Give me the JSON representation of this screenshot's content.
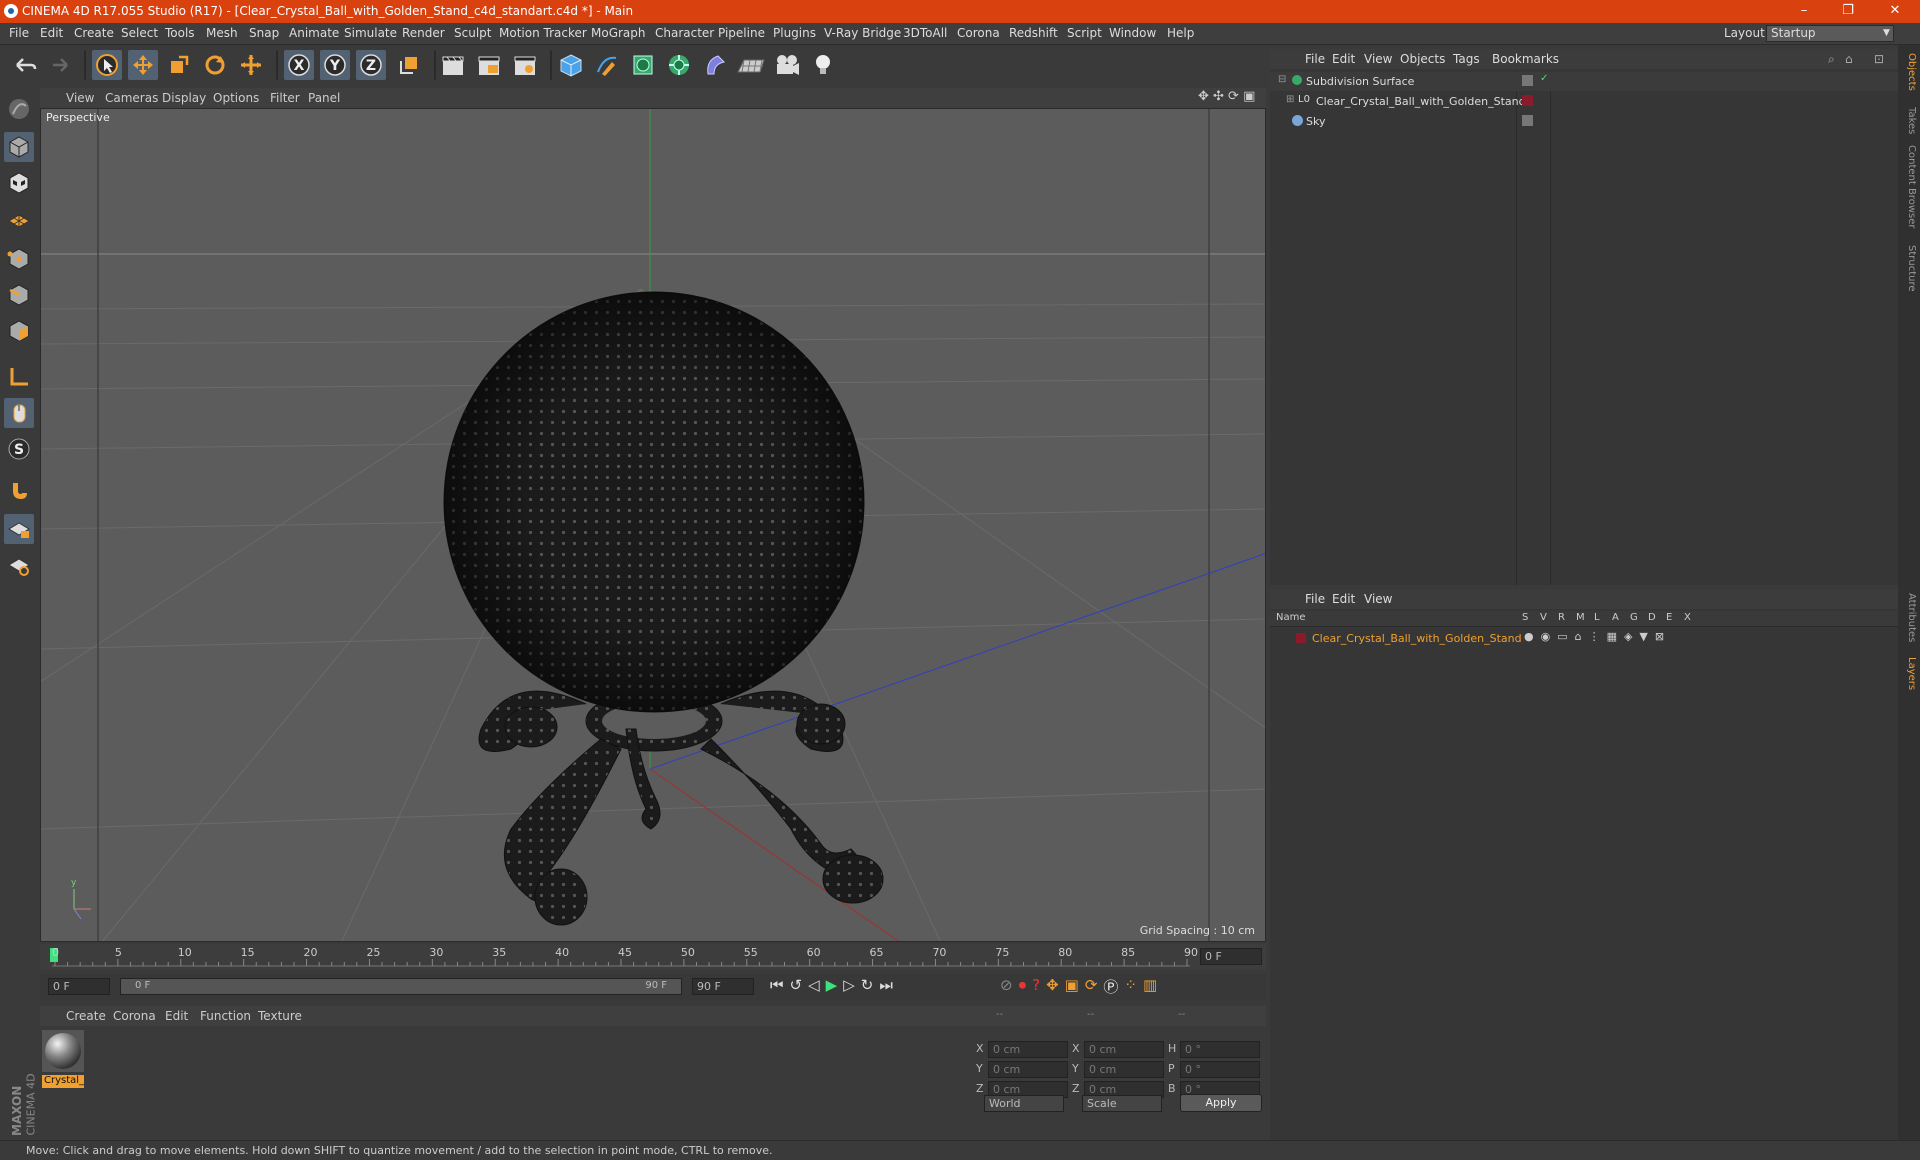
{
  "titlebar": {
    "title": "CINEMA 4D R17.055 Studio (R17) - [Clear_Crystal_Ball_with_Golden_Stand_c4d_standart.c4d *] - Main",
    "min": "–",
    "max": "❐",
    "close": "✕"
  },
  "menubar": {
    "items": [
      "File",
      "Edit",
      "Create",
      "Select",
      "Tools",
      "Mesh",
      "Snap",
      "Animate",
      "Simulate",
      "Render",
      "Sculpt",
      "Motion Tracker",
      "MoGraph",
      "Character",
      "Pipeline",
      "Plugins",
      "V-Ray Bridge",
      "3DToAll",
      "Corona",
      "Redshift",
      "Script",
      "Window",
      "Help"
    ],
    "layout_label": "Layout:",
    "layout_value": "Startup"
  },
  "viewport": {
    "menu": [
      "View",
      "Cameras",
      "Display",
      "Options",
      "Filter",
      "Panel"
    ],
    "label": "Perspective",
    "grid_spacing": "Grid Spacing : 10 cm"
  },
  "timeline": {
    "ticks": [
      "0",
      "5",
      "10",
      "15",
      "20",
      "25",
      "30",
      "35",
      "40",
      "45",
      "50",
      "55",
      "60",
      "65",
      "70",
      "75",
      "80",
      "85",
      "90"
    ],
    "current_frame": "0 F"
  },
  "timectl": {
    "start": "0 F",
    "slider_left": "0 F",
    "slider_right": "90 F",
    "end": "90 F"
  },
  "materials": {
    "menu": [
      "Create",
      "Corona",
      "Edit",
      "Function",
      "Texture"
    ],
    "items": [
      {
        "name": "Crystal_"
      }
    ]
  },
  "coords": {
    "headers": [
      "--",
      "--",
      "--"
    ],
    "rows": [
      {
        "a": "X",
        "av": "0 cm",
        "b": "X",
        "bv": "0 cm",
        "c": "H",
        "cv": "0 °"
      },
      {
        "a": "Y",
        "av": "0 cm",
        "b": "Y",
        "bv": "0 cm",
        "c": "P",
        "cv": "0 °"
      },
      {
        "a": "Z",
        "av": "0 cm",
        "b": "Z",
        "bv": "0 cm",
        "c": "B",
        "cv": "0 °"
      }
    ],
    "world": "World",
    "scale": "Scale",
    "apply": "Apply"
  },
  "objects": {
    "menu": [
      "File",
      "Edit",
      "View",
      "Objects",
      "Tags",
      "Bookmarks"
    ],
    "items": [
      {
        "name": "Subdivision Surface"
      },
      {
        "name": "Clear_Crystal_Ball_with_Golden_Stand"
      },
      {
        "name": "Sky"
      }
    ]
  },
  "layers": {
    "menu": [
      "File",
      "Edit",
      "View"
    ],
    "columns": [
      "Name",
      "S",
      "V",
      "R",
      "M",
      "L",
      "A",
      "G",
      "D",
      "E",
      "X"
    ],
    "items": [
      {
        "name": "Clear_Crystal_Ball_with_Golden_Stand"
      }
    ]
  },
  "rightstrip": {
    "tabs": [
      "Objects",
      "Takes",
      "Content Browser",
      "Structure",
      "Attributes",
      "Layers"
    ]
  },
  "brand": {
    "line1": "MAXON",
    "line2": "CINEMA 4D"
  },
  "status": {
    "text": "Move: Click and drag to move elements. Hold down SHIFT to quantize movement / add to the selection in point mode, CTRL to remove."
  },
  "colors": {
    "title_bg": "#d9410e",
    "accent_orange": "#f0a030",
    "layer_red": "#8b1a2a"
  }
}
